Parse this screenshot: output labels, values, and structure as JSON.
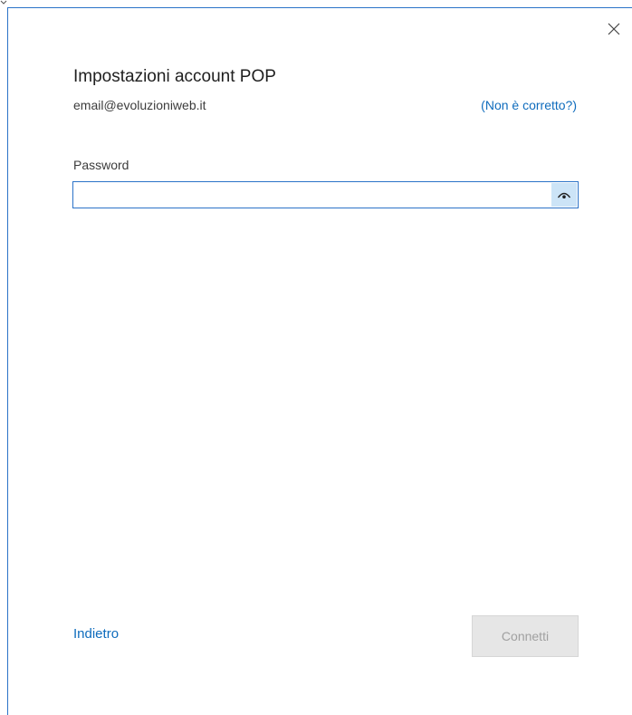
{
  "dialog": {
    "title": "Impostazioni account POP",
    "email": "email@evoluzioniweb.it",
    "not_correct_link": "(Non è corretto?)",
    "close_icon": "close-icon"
  },
  "password": {
    "label": "Password",
    "value": "",
    "placeholder": "",
    "reveal_icon": "eye-icon"
  },
  "footer": {
    "back_label": "Indietro",
    "connect_label": "Connetti",
    "connect_enabled": false
  },
  "colors": {
    "accent": "#0f6cbd",
    "focus_border": "#2b73c8",
    "reveal_bg": "#cce4f7",
    "disabled_bg": "#e6e6e6",
    "disabled_text": "#a0a0a0"
  }
}
